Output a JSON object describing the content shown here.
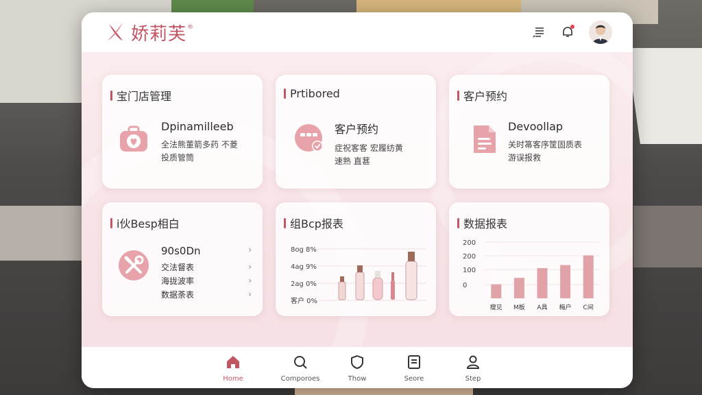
{
  "brand": {
    "name": "娇莉芙",
    "reg": "®",
    "accent": "#c25563"
  },
  "header": {
    "icons": [
      "list-icon",
      "bell-icon",
      "user-avatar"
    ]
  },
  "cards": [
    {
      "title": "宝门店管理",
      "icon": "briefcase-heart-icon",
      "subtitle": "Dpinamilleeb",
      "desc": [
        "全法熊董箭多药 不菱",
        "投质管筒"
      ]
    },
    {
      "title": "Prtibored",
      "icon": "chat-check-icon",
      "subtitle": "客户预约",
      "desc": [
        "症祝客客 宏履纺黄",
        "速熟 直葚"
      ]
    },
    {
      "title": "客户预约",
      "icon": "document-icon",
      "subtitle": "Devoollap",
      "desc": [
        "关时箒客序筐固质表",
        "游误报救"
      ]
    },
    {
      "title": "i伙Besp相白",
      "icon": "tools-icon",
      "subtitle": "90s0Dn",
      "items": [
        "交法督表",
        "海拢波率",
        "数据荼表"
      ]
    },
    {
      "title": "组Bcp报表",
      "icon": "products",
      "yticks": [
        "8og 8%",
        "4ag 9%",
        "2ag 0%",
        "客户 0%"
      ]
    },
    {
      "title": "数据报表",
      "icon": "bar-chart"
    }
  ],
  "chart_data": {
    "type": "bar",
    "title": "数据报表",
    "categories": [
      "瘦见",
      "M板",
      "A具",
      "梅户",
      "C间"
    ],
    "values": [
      55,
      80,
      118,
      130,
      168
    ],
    "yticks": [
      "200",
      "200",
      "100",
      "0"
    ],
    "ylim": [
      0,
      220
    ],
    "color": "#e2a3a8"
  },
  "tabbar": {
    "tabs": [
      {
        "label": "Home",
        "icon": "home-icon",
        "active": true
      },
      {
        "label": "Comporoes",
        "icon": "search-icon",
        "active": false
      },
      {
        "label": "Thow",
        "icon": "shield-icon",
        "active": false
      },
      {
        "label": "Seore",
        "icon": "document-icon",
        "active": false
      },
      {
        "label": "Step",
        "icon": "user-icon",
        "active": false
      }
    ]
  }
}
